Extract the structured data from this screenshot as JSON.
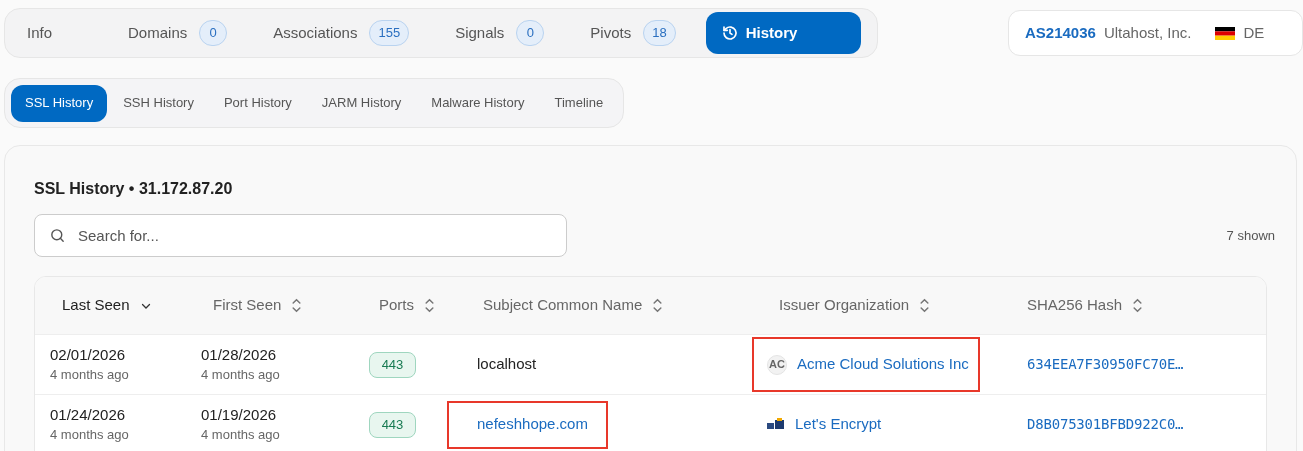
{
  "main_tabs": [
    {
      "label": "Info",
      "selected": false
    },
    {
      "label": "Domains",
      "count": "0",
      "selected": false
    },
    {
      "label": "Associations",
      "count": "155",
      "selected": false
    },
    {
      "label": "Signals",
      "count": "0",
      "selected": false
    },
    {
      "label": "Pivots",
      "count": "18",
      "selected": false
    },
    {
      "label": "History",
      "selected": true
    }
  ],
  "asn": {
    "number": "AS214036",
    "name": "Ultahost, Inc.",
    "country": "DE"
  },
  "sub_tabs": [
    {
      "label": "SSL History",
      "selected": true
    },
    {
      "label": "SSH History",
      "selected": false
    },
    {
      "label": "Port History",
      "selected": false
    },
    {
      "label": "JARM History",
      "selected": false
    },
    {
      "label": "Malware History",
      "selected": false
    },
    {
      "label": "Timeline",
      "selected": false
    }
  ],
  "panel": {
    "title": "SSL History • 31.172.87.20",
    "search": {
      "placeholder": "Search for..."
    },
    "shown": "7 shown"
  },
  "table": {
    "columns": [
      {
        "label": "Last Seen",
        "kind": "desc"
      },
      {
        "label": "First Seen",
        "kind": "unsorted"
      },
      {
        "label": "Ports",
        "kind": "unsorted"
      },
      {
        "label": "Subject Common Name",
        "kind": "unsorted"
      },
      {
        "label": "Issuer Organization",
        "kind": "unsorted"
      },
      {
        "label": "SHA256 Hash",
        "kind": "unsorted"
      }
    ],
    "rows": [
      {
        "last_seen": "02/01/2026",
        "last_seen_ago": "4 months ago",
        "first_seen": "01/28/2026",
        "first_seen_ago": "4 months ago",
        "port": "443",
        "subject": {
          "text": "localhost",
          "link": false,
          "highlighted": false
        },
        "issuer": {
          "text": "Acme Cloud Solutions Inc",
          "kind": "initials",
          "initials": "AC",
          "highlighted": true
        },
        "hash": "634EEA7F30950FC70E…"
      },
      {
        "last_seen": "01/24/2026",
        "last_seen_ago": "4 months ago",
        "first_seen": "01/19/2026",
        "first_seen_ago": "4 months ago",
        "port": "443",
        "subject": {
          "text": "nefeshhope.com",
          "link": true,
          "highlighted": true
        },
        "issuer": {
          "text": "Let's Encrypt",
          "kind": "logo",
          "highlighted": false
        },
        "hash": "D8B075301BFBD922C0…"
      }
    ]
  }
}
